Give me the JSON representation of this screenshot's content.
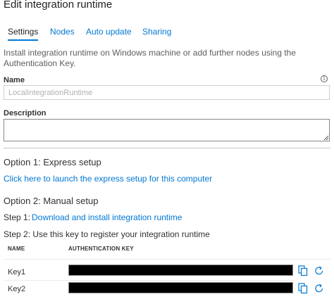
{
  "header": {
    "title": "Edit integration runtime"
  },
  "tabs": [
    {
      "label": "Settings",
      "active": true
    },
    {
      "label": "Nodes",
      "active": false
    },
    {
      "label": "Auto update",
      "active": false
    },
    {
      "label": "Sharing",
      "active": false
    }
  ],
  "intro": "Install integration runtime on Windows machine or add further nodes using the Authentication Key.",
  "name_field": {
    "label": "Name",
    "placeholder": "LocalIntegrationRuntime",
    "value": ""
  },
  "description_field": {
    "label": "Description",
    "value": ""
  },
  "option1": {
    "heading": "Option 1: Express setup",
    "link": "Click here to launch the express setup for this computer"
  },
  "option2": {
    "heading": "Option 2: Manual setup",
    "step1_prefix": "Step 1:",
    "step1_link": "Download and install integration runtime",
    "step2_text": "Step 2: Use this key to register your integration runtime"
  },
  "keys_table": {
    "columns": [
      "NAME",
      "AUTHENTICATION KEY"
    ],
    "rows": [
      {
        "name": "Key1",
        "value": ""
      },
      {
        "name": "Key2",
        "value": ""
      }
    ]
  },
  "icons": {
    "copy": "copy-icon",
    "refresh": "refresh-icon",
    "info": "info-icon"
  },
  "colors": {
    "accent": "#0078d4",
    "text": "#323130",
    "redacted": "#000000"
  }
}
